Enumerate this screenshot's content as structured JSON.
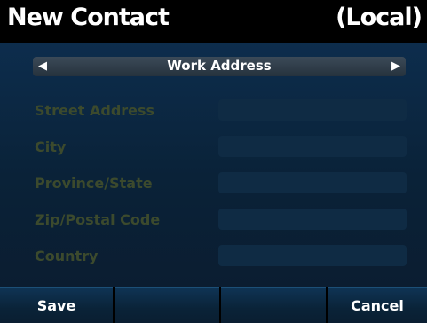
{
  "header": {
    "title": "New Contact",
    "scope": "(Local)"
  },
  "selector": {
    "label": "Work Address",
    "left_arrow_icon": "triangle-left-icon",
    "right_arrow_icon": "triangle-right-icon"
  },
  "form": {
    "fields": [
      {
        "label": "Street Address",
        "value": ""
      },
      {
        "label": "City",
        "value": ""
      },
      {
        "label": "Province/State",
        "value": ""
      },
      {
        "label": "Zip/Postal Code",
        "value": ""
      },
      {
        "label": "Country",
        "value": ""
      }
    ]
  },
  "softkeys": [
    {
      "label": "Save"
    },
    {
      "label": ""
    },
    {
      "label": ""
    },
    {
      "label": "Cancel"
    }
  ],
  "colors": {
    "header_bg": "#000000",
    "panel_bg": "#0b1f35",
    "label_text": "#3c4a2d",
    "field_bg": "#0f2b44",
    "text": "#ffffff"
  }
}
